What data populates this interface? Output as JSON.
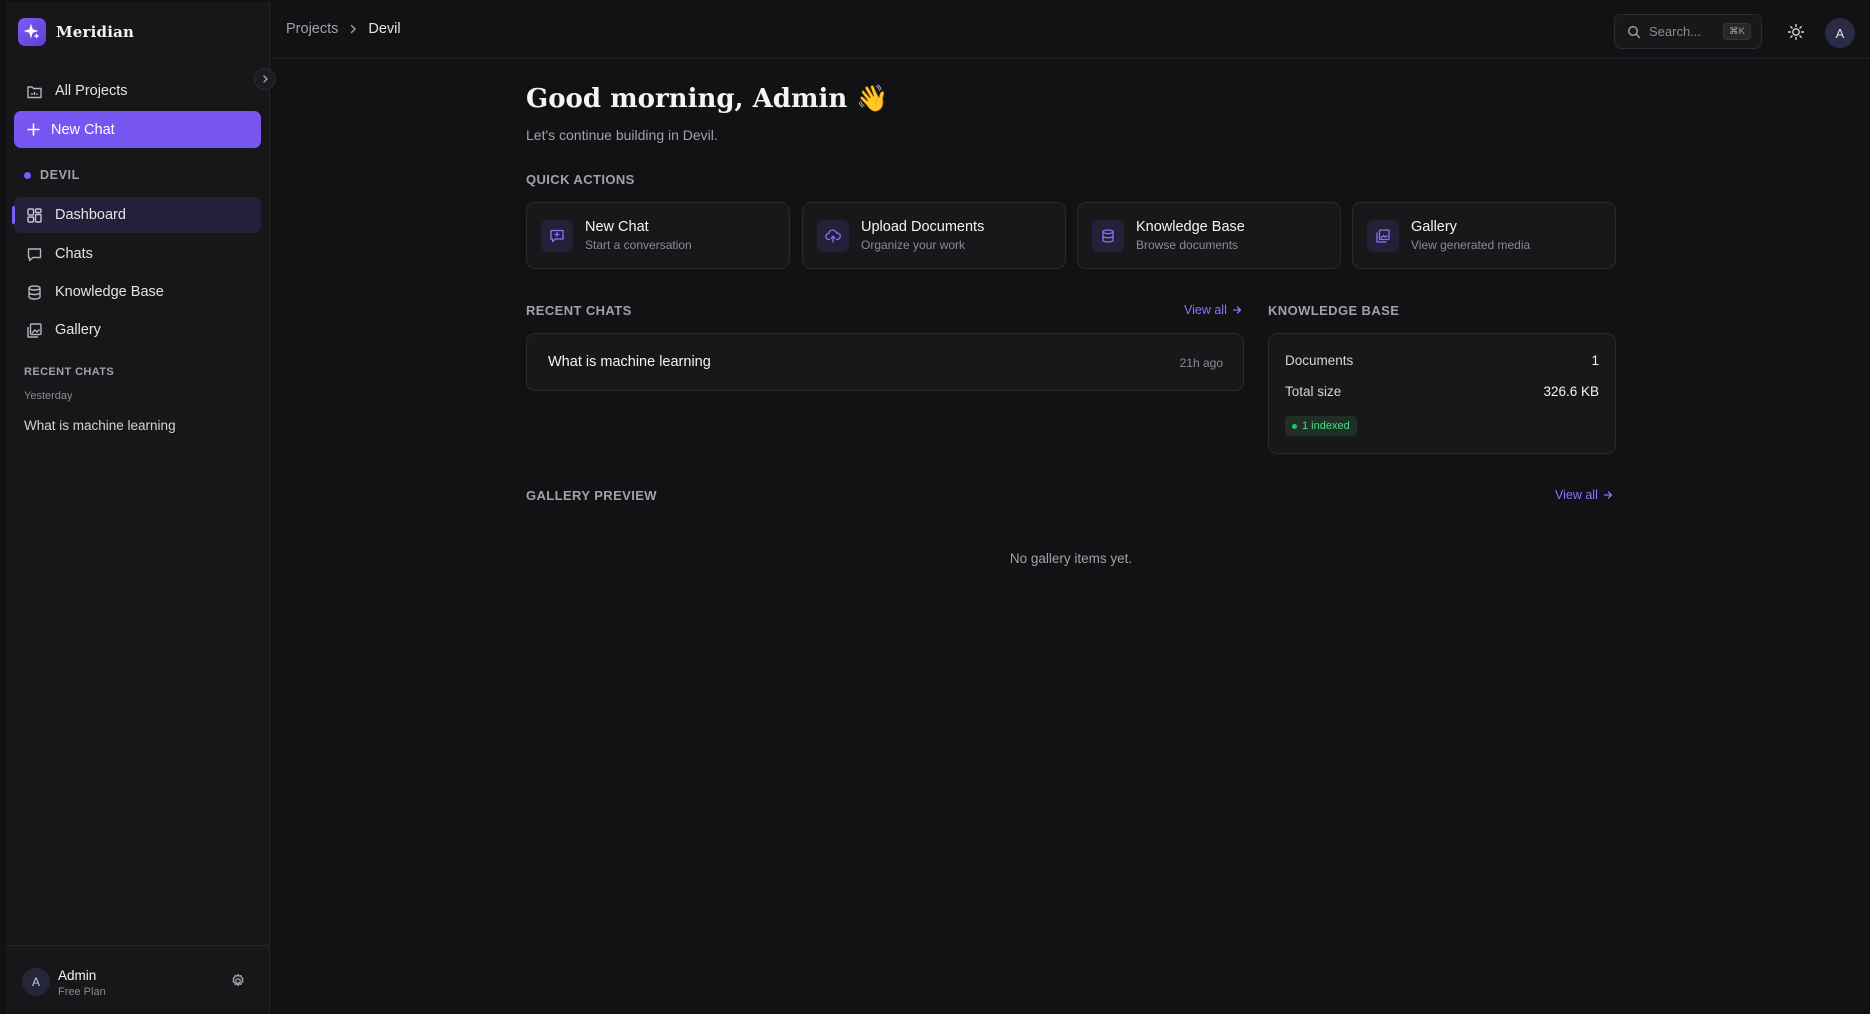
{
  "brand": {
    "name": "Meridian"
  },
  "sidebar": {
    "all_projects": "All Projects",
    "new_chat": "New Chat",
    "project_name": "DEVIL",
    "nav": [
      {
        "label": "Dashboard",
        "icon": "dashboard-icon",
        "active": true
      },
      {
        "label": "Chats",
        "icon": "chat-bubble-icon",
        "active": false
      },
      {
        "label": "Knowledge Base",
        "icon": "database-icon",
        "active": false
      },
      {
        "label": "Gallery",
        "icon": "gallery-icon",
        "active": false
      }
    ],
    "recent_heading": "RECENT CHATS",
    "recent_group": "Yesterday",
    "recent_items": [
      "What is machine learning"
    ],
    "user": {
      "avatar_initial": "A",
      "name": "Admin",
      "plan": "Free Plan"
    }
  },
  "topbar": {
    "breadcrumb": [
      "Projects",
      "Devil"
    ],
    "search_placeholder": "Search...",
    "search_shortcut": "⌘K",
    "avatar_initial": "A"
  },
  "main": {
    "greeting": "Good morning, Admin 👋",
    "subtitle": "Let's continue building in Devil.",
    "quick_actions_heading": "QUICK ACTIONS",
    "quick_actions": [
      {
        "label": "New Chat",
        "description": "Start a conversation",
        "icon": "chat-plus-icon"
      },
      {
        "label": "Upload Documents",
        "description": "Organize your work",
        "icon": "upload-cloud-icon"
      },
      {
        "label": "Knowledge Base",
        "description": "Browse documents",
        "icon": "database-icon"
      },
      {
        "label": "Gallery",
        "description": "View generated media",
        "icon": "gallery-icon"
      }
    ],
    "recent_chats_heading": "RECENT CHATS",
    "view_all": "View all",
    "recent_chats": [
      {
        "title": "What is machine learning",
        "time": "21h ago"
      }
    ],
    "knowledge_base_heading": "KNOWLEDGE BASE",
    "kb": {
      "documents_label": "Documents",
      "documents_value": "1",
      "size_label": "Total size",
      "size_value": "326.6 KB",
      "indexed_badge": "1 indexed"
    },
    "gallery_heading": "GALLERY PREVIEW",
    "gallery_empty": "No gallery items yet."
  },
  "colors": {
    "accent": "#7655f0",
    "link": "#8b73ff",
    "success": "#22c55e",
    "background": "#121214"
  }
}
